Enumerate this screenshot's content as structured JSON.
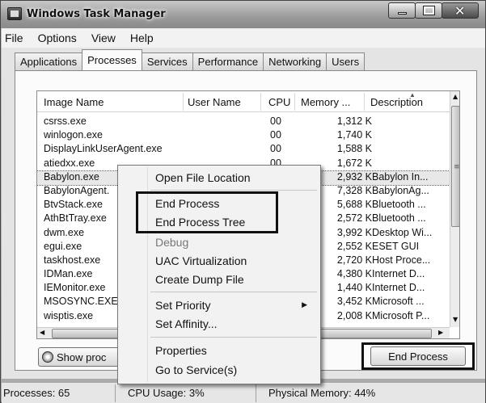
{
  "window": {
    "title": "Windows Task Manager"
  },
  "menubar": {
    "items": [
      "File",
      "Options",
      "View",
      "Help"
    ]
  },
  "tabs": [
    "Applications",
    "Processes",
    "Services",
    "Performance",
    "Networking",
    "Users"
  ],
  "active_tab": "Processes",
  "list": {
    "columns": [
      "Image Name",
      "User Name",
      "CPU",
      "Memory ...",
      "Description"
    ],
    "rows": [
      {
        "name": "csrss.exe",
        "user": "",
        "cpu": "00",
        "mem": "1,312 K",
        "desc": ""
      },
      {
        "name": "winlogon.exe",
        "user": "",
        "cpu": "00",
        "mem": "1,740 K",
        "desc": ""
      },
      {
        "name": "DisplayLinkUserAgent.exe",
        "user": "",
        "cpu": "00",
        "mem": "1,588 K",
        "desc": ""
      },
      {
        "name": "atiedxx.exe",
        "user": "",
        "cpu": "00",
        "mem": "1,672 K",
        "desc": ""
      },
      {
        "name": "Babylon.exe",
        "user": "",
        "cpu": "",
        "mem": "2,932 K",
        "desc": "Babylon In..."
      },
      {
        "name": "BabylonAgent.",
        "user": "",
        "cpu": "",
        "mem": "7,328 K",
        "desc": "BabylonAg..."
      },
      {
        "name": "BtvStack.exe",
        "user": "",
        "cpu": "",
        "mem": "5,688 K",
        "desc": "Bluetooth ..."
      },
      {
        "name": "AthBtTray.exe",
        "user": "",
        "cpu": "",
        "mem": "2,572 K",
        "desc": "Bluetooth ..."
      },
      {
        "name": "dwm.exe",
        "user": "",
        "cpu": "",
        "mem": "3,992 K",
        "desc": "Desktop Wi..."
      },
      {
        "name": "egui.exe",
        "user": "",
        "cpu": "",
        "mem": "2,552 K",
        "desc": "ESET GUI"
      },
      {
        "name": "taskhost.exe",
        "user": "",
        "cpu": "",
        "mem": "2,720 K",
        "desc": "Host Proce..."
      },
      {
        "name": "IDMan.exe",
        "user": "",
        "cpu": "",
        "mem": "4,380 K",
        "desc": "Internet D..."
      },
      {
        "name": "IEMonitor.exe",
        "user": "",
        "cpu": "",
        "mem": "1,440 K",
        "desc": "Internet D..."
      },
      {
        "name": "MSOSYNC.EXE",
        "user": "",
        "cpu": "",
        "mem": "3,452 K",
        "desc": "Microsoft ..."
      },
      {
        "name": "wisptis.exe",
        "user": "",
        "cpu": "",
        "mem": "2,008 K",
        "desc": "Microsoft P..."
      }
    ],
    "selected_index": 4
  },
  "buttons": {
    "show_processes": "Show proc",
    "end_process": "End Process"
  },
  "context_menu": {
    "items": [
      {
        "label": "Open File Location",
        "disabled": false
      },
      {
        "label": "End Process",
        "disabled": false
      },
      {
        "label": "End Process Tree",
        "disabled": false
      },
      {
        "label": "Debug",
        "disabled": true
      },
      {
        "label": "UAC Virtualization",
        "disabled": false
      },
      {
        "label": "Create Dump File",
        "disabled": false
      },
      {
        "label": "Set Priority",
        "disabled": false
      },
      {
        "label": "Set Affinity...",
        "disabled": false
      },
      {
        "label": "Properties",
        "disabled": false
      },
      {
        "label": "Go to Service(s)",
        "disabled": false
      }
    ]
  },
  "status": {
    "processes": "Processes: 65",
    "cpu": "CPU Usage: 3%",
    "memory": "Physical Memory: 44%"
  }
}
